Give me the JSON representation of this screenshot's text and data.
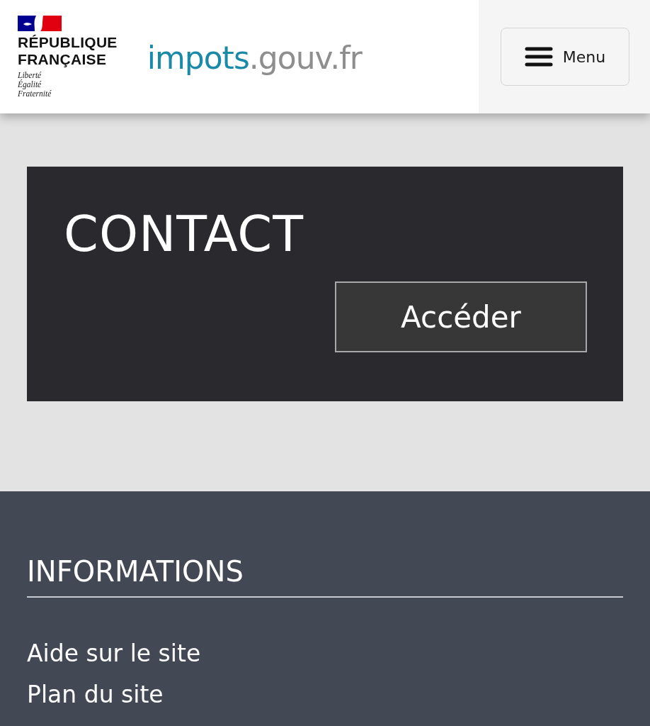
{
  "header": {
    "republic_name": "RÉPUBLIQUE\nFRANÇAISE",
    "motto": [
      "Liberté",
      "Égalité",
      "Fraternité"
    ],
    "site_logo": {
      "primary": "impots",
      "secondary": ".gouv.fr"
    },
    "menu_button": "Menu"
  },
  "contact_card": {
    "title": "CONTACT",
    "button": "Accéder"
  },
  "footer": {
    "heading": "INFORMATIONS",
    "links": [
      "Aide sur le site",
      "Plan du site"
    ]
  }
}
